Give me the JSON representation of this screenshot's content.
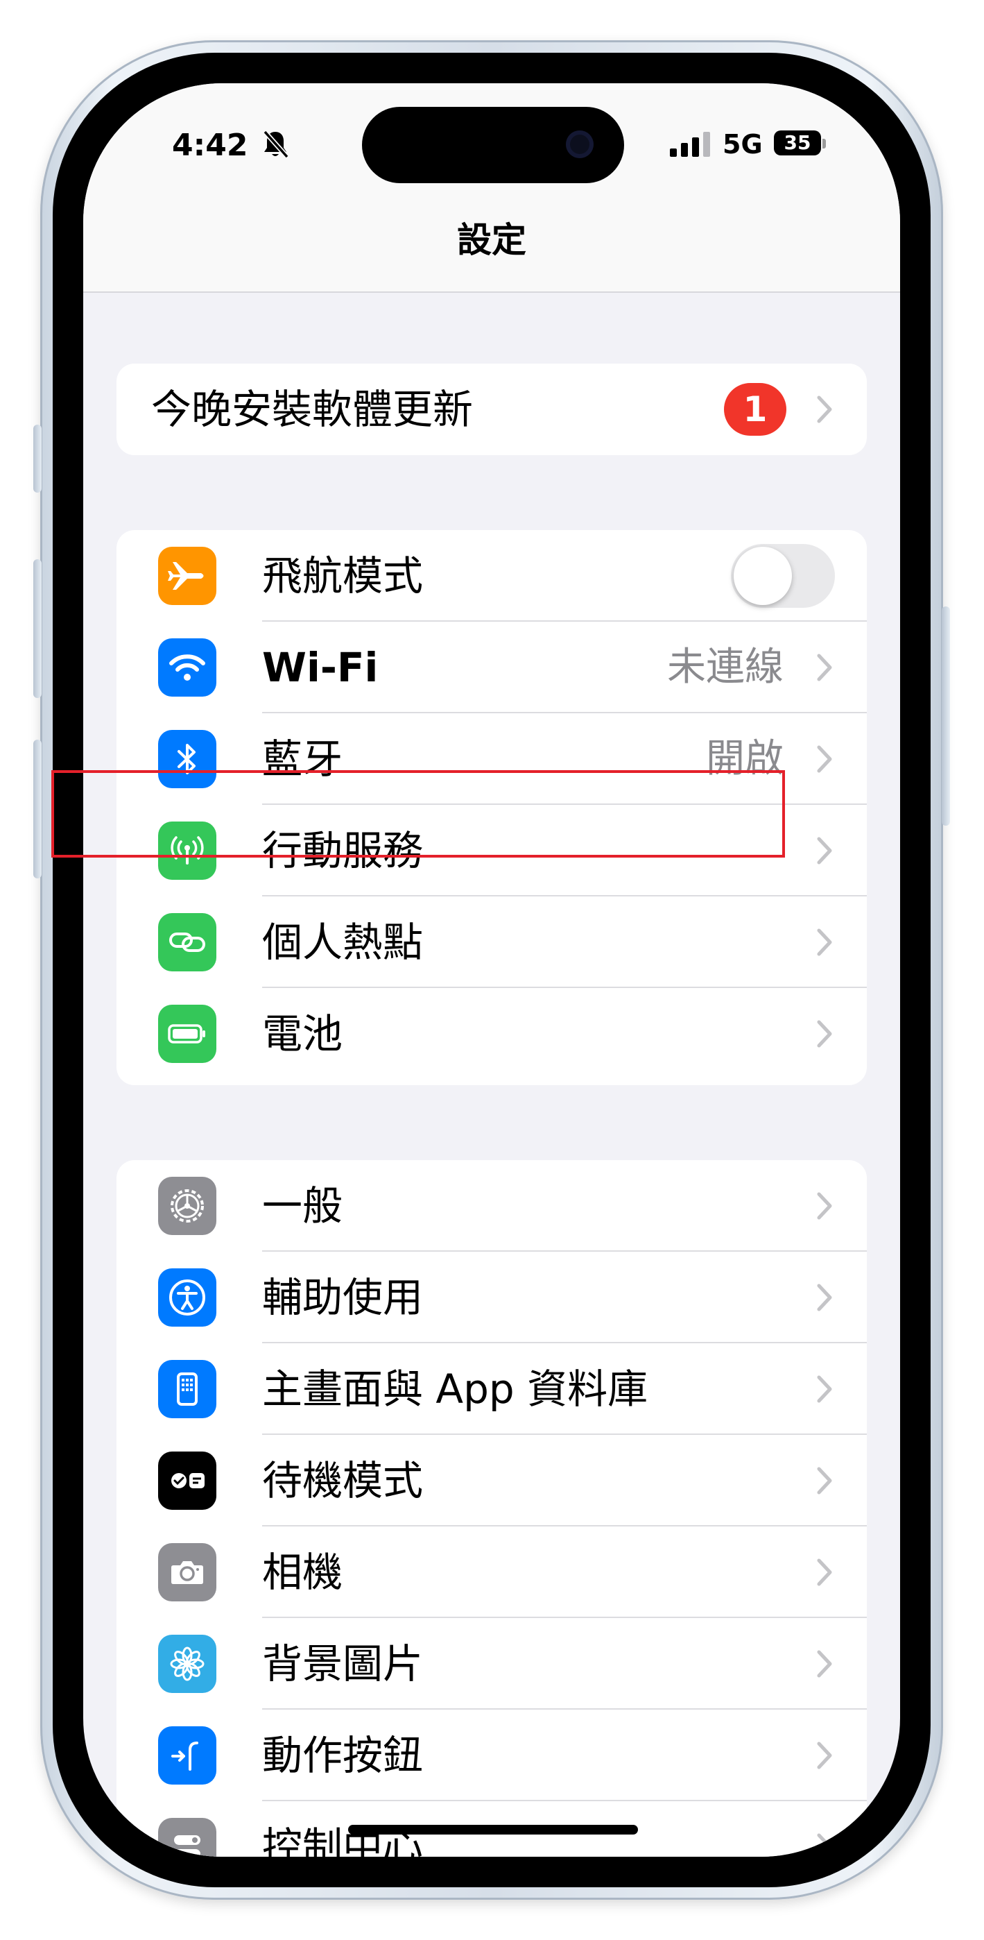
{
  "status_bar": {
    "time": "4:42",
    "network": "5G",
    "battery": "35"
  },
  "header": {
    "title": "設定"
  },
  "update_row": {
    "label": "今晚安裝軟體更新",
    "badge": "1"
  },
  "connectivity": [
    {
      "label": "飛航模式",
      "icon": "airplane-icon",
      "color": "#ff9500",
      "toggle": "off"
    },
    {
      "label": "Wi-Fi",
      "icon": "wifi-icon",
      "color": "#007aff",
      "value": "未連線"
    },
    {
      "label": "藍牙",
      "icon": "bluetooth-icon",
      "color": "#007aff",
      "value": "開啟"
    },
    {
      "label": "行動服務",
      "icon": "cellular-icon",
      "color": "#34c759"
    },
    {
      "label": "個人熱點",
      "icon": "hotspot-icon",
      "color": "#34c759"
    },
    {
      "label": "電池",
      "icon": "battery-icon",
      "color": "#34c759"
    }
  ],
  "general": [
    {
      "label": "一般",
      "icon": "gear-icon",
      "color": "#8e8e93"
    },
    {
      "label": "輔助使用",
      "icon": "accessibility-icon",
      "color": "#007aff"
    },
    {
      "label": "主畫面與 App 資料庫",
      "icon": "home-screen-icon",
      "color": "#007aff"
    },
    {
      "label": "待機模式",
      "icon": "standby-icon",
      "color": "#000000"
    },
    {
      "label": "相機",
      "icon": "camera-icon",
      "color": "#8e8e93"
    },
    {
      "label": "背景圖片",
      "icon": "wallpaper-icon",
      "color": "#32ade6"
    },
    {
      "label": "動作按鈕",
      "icon": "action-button-icon",
      "color": "#007aff"
    },
    {
      "label": "控制中心",
      "icon": "control-center-icon",
      "color": "#8e8e93"
    }
  ],
  "highlight_color": "#e4202a"
}
